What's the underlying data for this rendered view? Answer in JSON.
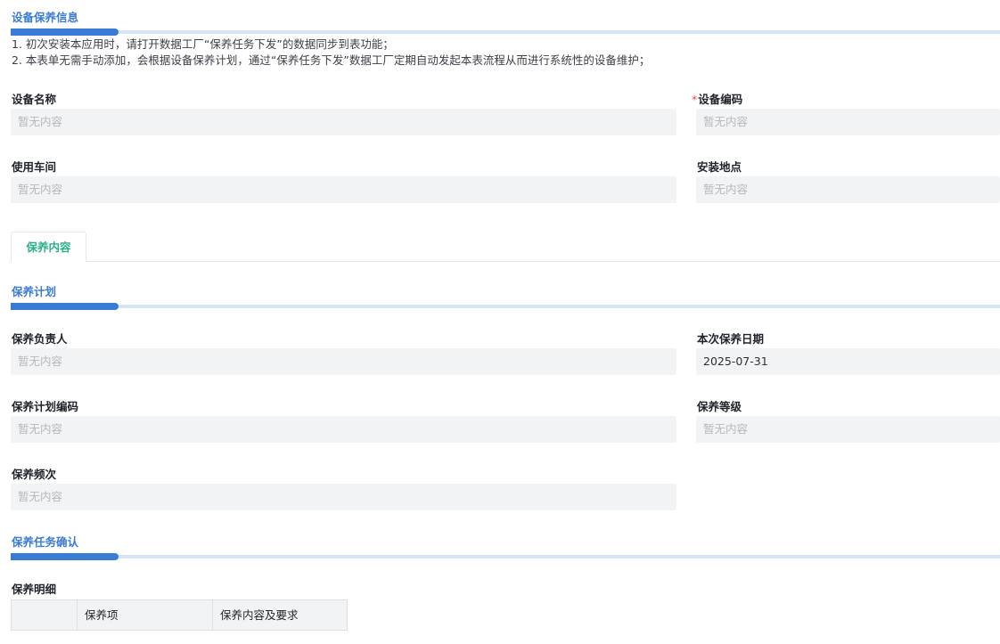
{
  "sections": {
    "equipment_info": "设备保养信息",
    "maintenance_plan": "保养计划",
    "task_confirm": "保养任务确认"
  },
  "notes": [
    "1. 初次安装本应用时，请打开数据工厂“保养任务下发”的数据同步到表功能；",
    "2. 本表单无需手动添加，会根据设备保养计划，通过“保养任务下发”数据工厂定期自动发起本表流程从而进行系统性的设备维护；"
  ],
  "placeholder": "暂无内容",
  "fields": {
    "device_name": {
      "label": "设备名称",
      "value": ""
    },
    "device_code": {
      "label": "设备编码",
      "required_mark": "*",
      "value": ""
    },
    "workshop": {
      "label": "使用车间",
      "value": ""
    },
    "location": {
      "label": "安装地点",
      "value": ""
    },
    "owner": {
      "label": "保养负责人",
      "value": ""
    },
    "date": {
      "label": "本次保养日期",
      "value": "2025-07-31"
    },
    "plan_code": {
      "label": "保养计划编码",
      "value": ""
    },
    "level": {
      "label": "保养等级",
      "value": ""
    },
    "frequency": {
      "label": "保养频次",
      "value": ""
    }
  },
  "tab": {
    "label": "保养内容"
  },
  "detail": {
    "label": "保养明细",
    "columns": [
      "",
      "保养项",
      "保养内容及要求"
    ]
  }
}
